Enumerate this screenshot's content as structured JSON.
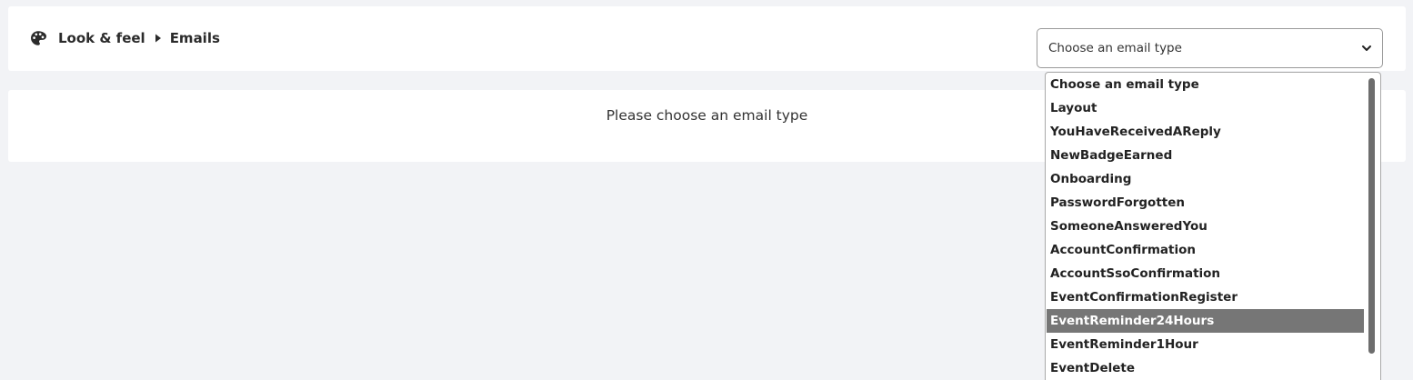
{
  "breadcrumb": {
    "icon": "palette-icon",
    "separator_icon": "caret-right-icon",
    "items": [
      "Look & feel",
      "Emails"
    ]
  },
  "select": {
    "value": "Choose an email type",
    "icon": "chevron-down-icon"
  },
  "content": {
    "message": "Please choose an email type"
  },
  "dropdown": {
    "selected": "EventReminder24Hours",
    "options": [
      "Choose an email type",
      "Layout",
      "YouHaveReceivedAReply",
      "NewBadgeEarned",
      "Onboarding",
      "PasswordForgotten",
      "SomeoneAnsweredYou",
      "AccountConfirmation",
      "AccountSsoConfirmation",
      "EventConfirmationRegister",
      "EventReminder24Hours",
      "EventReminder1Hour",
      "EventDelete"
    ]
  },
  "colors": {
    "page_bg": "#f2f3f6",
    "card_bg": "#ffffff",
    "selected_bg": "#767676",
    "text": "#2b2b2b"
  }
}
